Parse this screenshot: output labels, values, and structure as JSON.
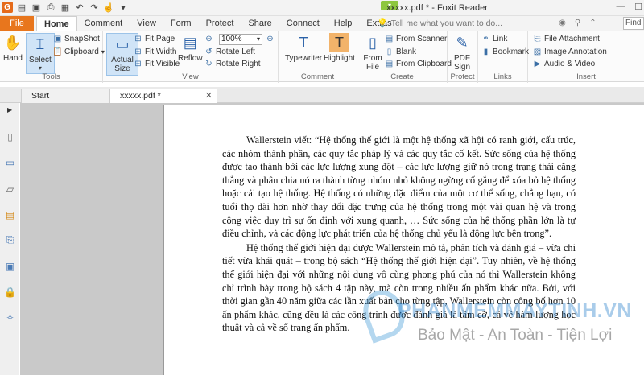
{
  "window": {
    "title": "xxxxx.pdf * - Foxit Reader"
  },
  "quick_access": [
    "foxit-logo-icon",
    "open-icon",
    "save-icon",
    "print-icon",
    "print-preview-icon",
    "undo-icon",
    "redo-icon",
    "hand-icon",
    "customize-icon"
  ],
  "tabs": {
    "file": "File",
    "items": [
      "Home",
      "Comment",
      "View",
      "Form",
      "Protect",
      "Share",
      "Connect",
      "Help",
      "Extras"
    ],
    "active": "Home"
  },
  "tell_me": {
    "placeholder": "Tell me what you want to do..."
  },
  "find": {
    "placeholder": "Find"
  },
  "ribbon": {
    "tools": {
      "label": "Tools",
      "hand": "Hand",
      "select": "Select",
      "snapshot": "SnapShot",
      "clipboard": "Clipboard"
    },
    "view": {
      "label": "View",
      "actual_size": "Actual Size",
      "fit_page": "Fit Page",
      "fit_width": "Fit Width",
      "fit_visible": "Fit Visible",
      "reflow": "Reflow",
      "zoom": "100%",
      "rotate_left": "Rotate Left",
      "rotate_right": "Rotate Right"
    },
    "comment": {
      "label": "Comment",
      "typewriter": "Typewriter",
      "highlight": "Highlight"
    },
    "create": {
      "label": "Create",
      "from_file": "From File",
      "from_scanner": "From Scanner",
      "blank": "Blank",
      "from_clipboard": "From Clipboard"
    },
    "protect": {
      "label": "Protect",
      "pdf_sign": "PDF Sign"
    },
    "links": {
      "label": "Links",
      "link": "Link",
      "bookmark": "Bookmark"
    },
    "insert": {
      "label": "Insert",
      "file_attachment": "File Attachment",
      "image_annotation": "Image Annotation",
      "audio_video": "Audio & Video"
    }
  },
  "doc_tabs": [
    {
      "label": "Start"
    },
    {
      "label": "xxxxx.pdf *"
    }
  ],
  "document": {
    "paragraphs": [
      "Wallerstein viết: “Hệ thống thế giới là một hệ thống xã hội có ranh giới, cấu trúc, các nhóm thành phần, các quy tắc pháp lý và các quy tắc cố kết. Sức sống của hệ thống được tạo thành bởi các lực lượng xung đột – các lực lượng giữ nó trong trạng thái căng thẳng và phân chia nó ra thành từng nhóm nhỏ không ngừng cố gắng để xóa bỏ hệ thống hoặc cải tạo hệ thống. Hệ thống có những đặc điểm của một cơ thể sống, chẳng hạn, có tuổi thọ dài hơn nhờ thay đổi đặc trưng của hệ thống trong một vài quan hệ và trong công việc duy trì sự ổn định với xung quanh, … Sức sống của hệ thống phần lớn là tự điều chỉnh, và các động lực phát triển của hệ thống chủ yếu là động lực bên trong”.",
      "Hệ thống thế giới hiện đại được Wallerstein mô tả, phân tích và đánh giá – vừa chi tiết vừa khái quát – trong bộ sách “Hệ thống thế giới hiện đại”. Tuy nhiên, về hệ thống thế giới hiện đại với những nội dung vô cùng phong phú của nó thì Wallerstein không chỉ trình bày trong bộ sách 4 tập này, mà còn trong nhiều ấn phẩm khác nữa. Bởi, với thời gian gần 40 năm giữa các lần xuất bản cho từng tập, Wallerstein còn công bố hơn 10 ấn phẩm khác, cũng đều là các công trình được đánh giá là tầm cỡ, cả về hàm lượng học thuật và cả về số trang ấn phẩm."
    ]
  },
  "watermark": {
    "brand": "PHANMEMMAYTINH.VN",
    "tagline": "Bảo Mật - An Toàn - Tiện Lợi"
  }
}
